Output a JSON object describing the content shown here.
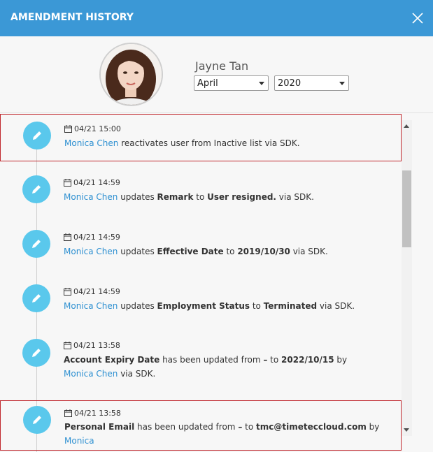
{
  "header": {
    "title": "AMENDMENT HISTORY"
  },
  "profile": {
    "name": "Jayne Tan",
    "month": "April",
    "year": "2020"
  },
  "colors": {
    "header": "#3b98d6",
    "icon": "#5ac8ec",
    "link": "#2e90d1",
    "highlight": "#c0272d"
  },
  "icons": {
    "close": "close-icon",
    "entry": "pencil-icon",
    "time": "calendar-icon"
  },
  "entries": [
    {
      "time": "04/21 15:00",
      "user": "Monica Chen",
      "p1": " reactivates user from Inactive list via SDK."
    },
    {
      "time": "04/21 14:59",
      "user": "Monica Chen",
      "p1": " updates ",
      "b1": "Remark",
      "p2": " to ",
      "b2": "User resigned.",
      "p3": " via SDK."
    },
    {
      "time": "04/21 14:59",
      "user": "Monica Chen",
      "p1": " updates ",
      "b1": "Effective Date",
      "p2": " to ",
      "b2": "2019/10/30",
      "p3": " via SDK."
    },
    {
      "time": "04/21 14:59",
      "user": "Monica Chen",
      "p1": " updates ",
      "b1": "Employment Status",
      "p2": " to ",
      "b2": "Terminated",
      "p3": " via SDK."
    },
    {
      "time": "04/21 13:58",
      "b1": "Account Expiry Date",
      "p1": " has been updated from ",
      "b2": "–",
      "p2": " to ",
      "b3": "2022/10/15",
      "p3": " by ",
      "user": "Monica Chen",
      "p4": " via SDK."
    },
    {
      "time": "04/21 13:58",
      "b1": "Personal Email",
      "p1": " has been updated from ",
      "b2": "–",
      "p2": " to ",
      "b3": "tmc@timeteccloud.com",
      "p3": " by ",
      "user": "Monica"
    }
  ]
}
